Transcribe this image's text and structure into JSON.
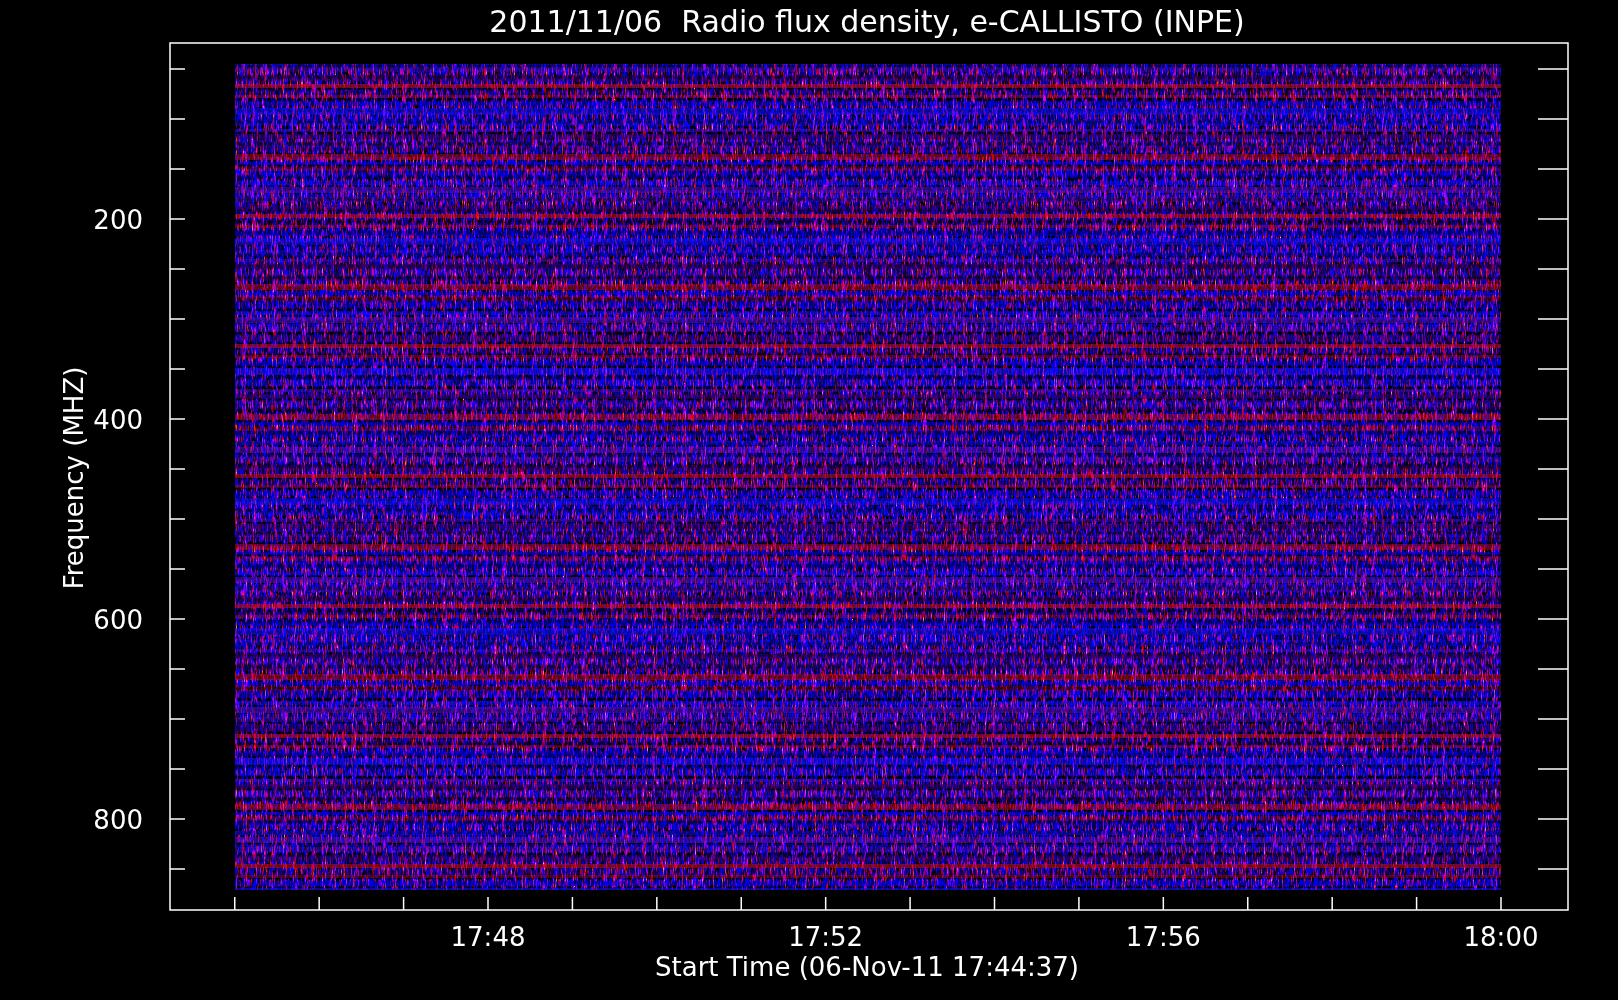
{
  "title": "2011/11/06  Radio flux density, e-CALLISTO (INPE)",
  "y_axis": {
    "label": "Frequency (MHZ)",
    "ticks": [
      "200",
      "400",
      "600",
      "800"
    ]
  },
  "x_axis": {
    "label": "Start Time (06-Nov-11 17:44:37)",
    "ticks": [
      "17:48",
      "17:52",
      "17:56",
      "18:00"
    ]
  }
}
